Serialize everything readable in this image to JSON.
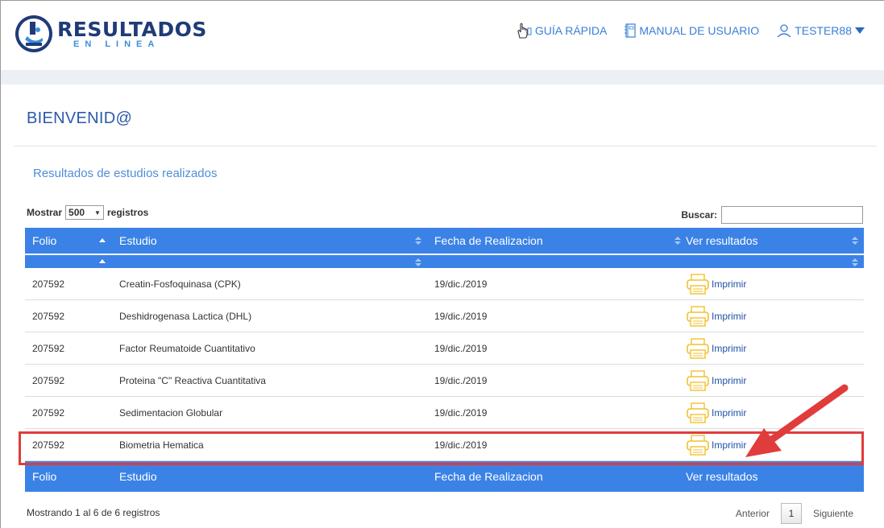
{
  "brand": {
    "word": "RESULTADOS",
    "sub": "EN LINEA"
  },
  "nav": {
    "guide": "GUÍA RÁPIDA",
    "manual": "MANUAL DE USUARIO",
    "user": "TESTER88"
  },
  "welcome": "BIENVENID@",
  "section_title": "Resultados de estudios realizados",
  "controls": {
    "show_label": "Mostrar",
    "page_size": "500",
    "records_label": "registros",
    "search_label": "Buscar:",
    "search_value": ""
  },
  "table": {
    "headers": [
      "Folio",
      "Estudio",
      "Fecha de Realizacion",
      "Ver resultados"
    ],
    "rows": [
      {
        "folio": "207592",
        "estudio": "Creatin-Fosfoquinasa (CPK)",
        "fecha": "19/dic./2019",
        "accion": "Imprimir"
      },
      {
        "folio": "207592",
        "estudio": "Deshidrogenasa Lactica (DHL)",
        "fecha": "19/dic./2019",
        "accion": "Imprimir"
      },
      {
        "folio": "207592",
        "estudio": "Factor Reumatoide Cuantitativo",
        "fecha": "19/dic./2019",
        "accion": "Imprimir"
      },
      {
        "folio": "207592",
        "estudio": "Proteina \"C\" Reactiva Cuantitativa",
        "fecha": "19/dic./2019",
        "accion": "Imprimir"
      },
      {
        "folio": "207592",
        "estudio": "Sedimentacion Globular",
        "fecha": "19/dic./2019",
        "accion": "Imprimir"
      },
      {
        "folio": "207592",
        "estudio": "Biometria Hematica",
        "fecha": "19/dic./2019",
        "accion": "Imprimir"
      }
    ]
  },
  "footer_info": "Mostrando 1 al 6 de 6 registros",
  "pager": {
    "prev": "Anterior",
    "page": "1",
    "next": "Siguiente"
  },
  "colors": {
    "header_blue": "#3b82e6",
    "highlight_red": "#e03c3c",
    "link_blue": "#2051a8",
    "printer_yellow": "#f2c12e"
  }
}
